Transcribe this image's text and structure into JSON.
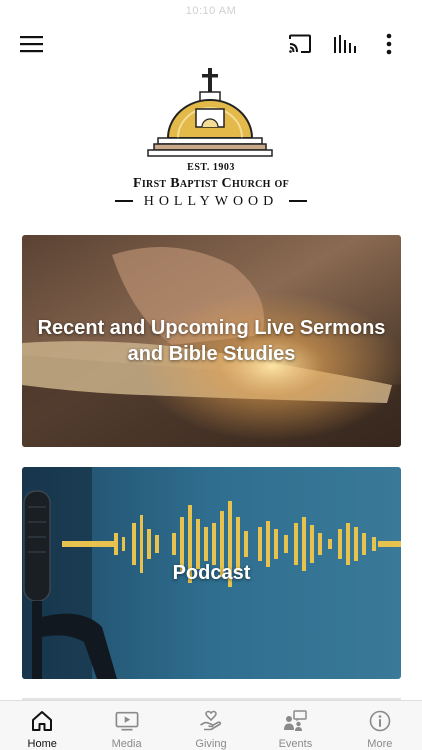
{
  "status_bar": {
    "time": "10:10 AM"
  },
  "header": {
    "menu_icon": "hamburger-menu-icon",
    "cast_icon": "cast-icon",
    "audio_icon": "audio-bars-icon",
    "more_icon": "more-vertical-icon"
  },
  "logo": {
    "established": "EST. 1903",
    "name": "First Baptist Church of",
    "city": "HOLLYWOOD"
  },
  "cards": [
    {
      "title": "Recent and Upcoming Live Sermons and Bible Studies"
    },
    {
      "title": "Podcast"
    }
  ],
  "tabs": [
    {
      "label": "Home",
      "icon": "home-icon",
      "active": true
    },
    {
      "label": "Media",
      "icon": "media-player-icon",
      "active": false
    },
    {
      "label": "Giving",
      "icon": "giving-hand-heart-icon",
      "active": false
    },
    {
      "label": "Events",
      "icon": "events-people-icon",
      "active": false
    },
    {
      "label": "More",
      "icon": "info-circle-icon",
      "active": false
    }
  ],
  "colors": {
    "active_tab": "#111111",
    "inactive_tab": "#8a8a8a",
    "logo_gold": "#e3b94a",
    "podcast_blue": "#2a6a8a"
  }
}
